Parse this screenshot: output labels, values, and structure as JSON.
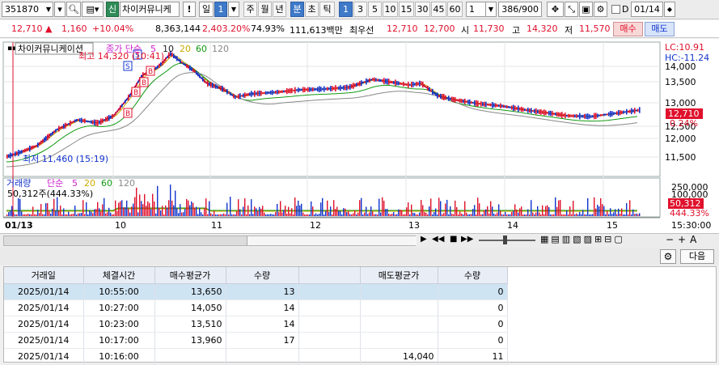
{
  "toolbar": {
    "code": "351870",
    "market_badge": "신",
    "stock_name": "차이커뮤니케",
    "bang": "!",
    "period_day": "일",
    "period_day_value": "1",
    "period_week": "주",
    "period_month": "월",
    "period_year": "년",
    "period_min": "분",
    "period_tick_cho": "초",
    "period_tick": "틱",
    "intervals": [
      "1",
      "3",
      "5",
      "10",
      "15",
      "30",
      "45",
      "60"
    ],
    "interval_value": "1",
    "count": "386/900",
    "date_value": "01/14",
    "checkbox_label": "D"
  },
  "quote": {
    "price": "12,710",
    "change": "1,160",
    "change_pct": "+10.04%",
    "volume": "8,363,144",
    "vol_ratio": "2,403.20%",
    "strength": "74.93%",
    "amount": "111,613백만",
    "best_label": "최우선",
    "best_ask": "12,710",
    "best_bid": "12,700",
    "open_label": "시",
    "open": "11,730",
    "high_label": "고",
    "high": "14,320",
    "low_label": "저",
    "low": "11,570",
    "buy_label": "매수",
    "sell_label": "매도"
  },
  "price_chart": {
    "name_box": "차이커뮤니케이션",
    "ma_label": "종가 단순",
    "ma_periods": [
      "5",
      "10",
      "20",
      "60",
      "120"
    ],
    "ma_colors": [
      "#cc22cc",
      "#222222",
      "#ccaa00",
      "#119911",
      "#888888"
    ],
    "high_note": "최고 14,320 (10:41)",
    "low_note": "최저 11,460 (15:19)",
    "lc": "LC:10.91",
    "hc": "HC:-11.24",
    "y_ticks": [
      "14,000",
      "13,500",
      "13,000",
      "12,500",
      "12,000",
      "11,500"
    ],
    "last_price": "12,710",
    "last_pct": "0.24%"
  },
  "volume_chart": {
    "title": "거래량",
    "ma_label": "단순",
    "ma_periods": [
      "5",
      "20",
      "60",
      "120"
    ],
    "ma_colors": [
      "#cc22cc",
      "#ccaa00",
      "#119911",
      "#888888"
    ],
    "last_volume": "50,312주(444.33%)",
    "y_ticks": [
      "250,000",
      "100,000"
    ],
    "last_value": "50,312",
    "last_pct": "444.33%"
  },
  "time_axis": {
    "labels": [
      "01/13",
      "10",
      "11",
      "12",
      "13",
      "14",
      "15"
    ],
    "end_time": "15:30:00"
  },
  "bottom": {
    "next_label": "다음"
  },
  "table": {
    "columns": [
      "거래일",
      "체결시간",
      "매수평균가",
      "수량",
      "",
      "매도평균가",
      "수량"
    ],
    "rows": [
      {
        "date": "2025/01/14",
        "time": "10:55:00",
        "buy_avg": "13,650",
        "buy_qty": "13",
        "sell_avg": "",
        "sell_qty": "0"
      },
      {
        "date": "2025/01/14",
        "time": "10:27:00",
        "buy_avg": "14,050",
        "buy_qty": "14",
        "sell_avg": "",
        "sell_qty": "0"
      },
      {
        "date": "2025/01/14",
        "time": "10:23:00",
        "buy_avg": "13,510",
        "buy_qty": "14",
        "sell_avg": "",
        "sell_qty": "0"
      },
      {
        "date": "2025/01/14",
        "time": "10:17:00",
        "buy_avg": "13,960",
        "buy_qty": "17",
        "sell_avg": "",
        "sell_qty": "0"
      },
      {
        "date": "2025/01/14",
        "time": "10:16:00",
        "buy_avg": "",
        "buy_qty": "",
        "sell_avg": "14,040",
        "sell_qty": "11"
      }
    ]
  },
  "colors": {
    "up": "#e0102c",
    "down": "#1133cc",
    "selected": "#3f7ac9"
  }
}
